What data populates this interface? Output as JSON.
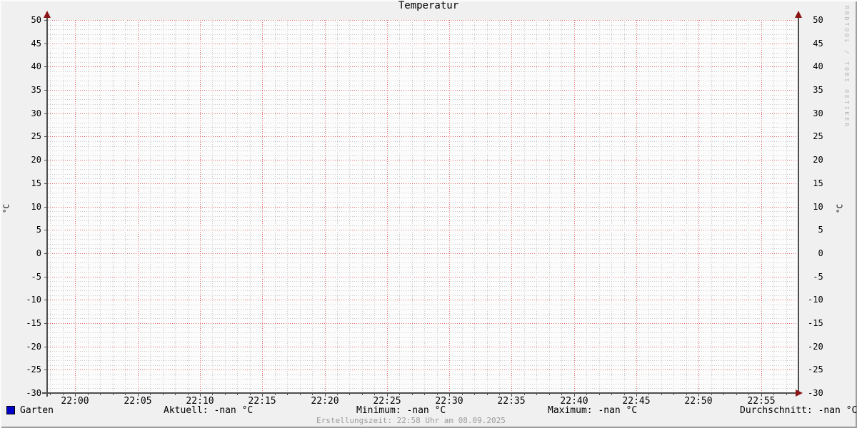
{
  "title": "Temperatur",
  "watermark": "RRDTOOL / TOBI OETIKER",
  "axis": {
    "left_unit": "°C",
    "right_unit": "°C"
  },
  "legend": {
    "series_label": "Garten",
    "swatch_color": "#0000c8"
  },
  "stats": {
    "aktuell": "Aktuell: -nan °C",
    "minimum": "Minimum: -nan °C",
    "maximum": "Maximum: -nan °C",
    "durchschnitt": "Durchschnitt: -nan °C"
  },
  "footer": {
    "creation": "Erstellungszeit: 22:58 Uhr am 08.09.2025"
  },
  "chart_data": {
    "type": "line",
    "title": "Temperatur",
    "xlabel": "",
    "ylabel": "°C",
    "ylim": [
      -30,
      50
    ],
    "y_ticks": [
      50,
      45,
      40,
      35,
      30,
      25,
      20,
      15,
      10,
      5,
      0,
      -5,
      -10,
      -15,
      -20,
      -25,
      -30
    ],
    "y_major_step": 5,
    "y_minor_step": 1,
    "x_ticks": [
      "22:00",
      "22:05",
      "22:10",
      "22:15",
      "22:20",
      "22:25",
      "22:30",
      "22:35",
      "22:40",
      "22:45",
      "22:50",
      "22:55"
    ],
    "x_tick_minutes": [
      0,
      5,
      10,
      15,
      20,
      25,
      30,
      35,
      40,
      45,
      50,
      55
    ],
    "x_range_minutes": [
      -2.2,
      58
    ],
    "x_minor_step_minutes": 1,
    "grid": {
      "on": true,
      "style": "dotted",
      "major_color": "#e06868",
      "minor_color": "#c9c9c9"
    },
    "legend_position": "bottom",
    "series": [
      {
        "name": "Garten",
        "color": "#0000c8",
        "values": [],
        "aktuell": "-nan °C",
        "minimum": "-nan °C",
        "maximum": "-nan °C",
        "durchschnitt": "-nan °C"
      }
    ]
  }
}
